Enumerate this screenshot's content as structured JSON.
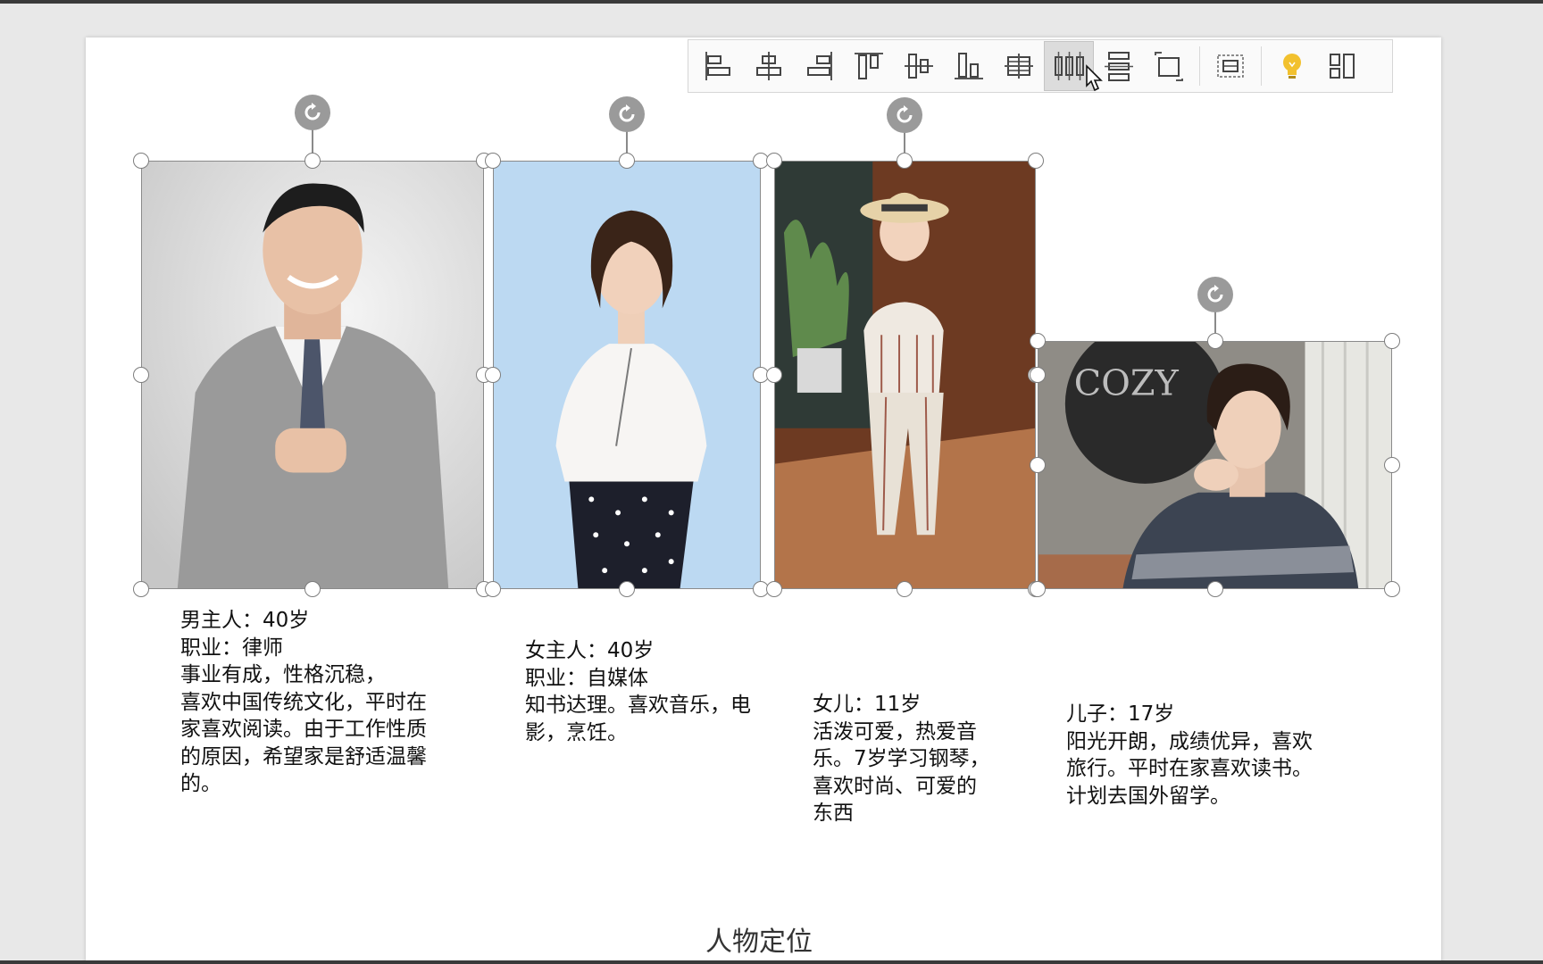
{
  "toolbar": {
    "buttons": [
      {
        "icon": "align-left-icon"
      },
      {
        "icon": "align-center-horizontal-icon"
      },
      {
        "icon": "align-right-icon"
      },
      {
        "icon": "align-top-icon"
      },
      {
        "icon": "align-middle-vertical-icon"
      },
      {
        "icon": "align-bottom-icon"
      },
      {
        "icon": "align-center-both-icon"
      },
      {
        "icon": "distribute-horizontal-icon",
        "active": true
      },
      {
        "icon": "distribute-vertical-icon"
      },
      {
        "icon": "fit-to-slide-icon"
      },
      {
        "icon": "align-to-slide-icon"
      },
      {
        "icon": "lightbulb-icon"
      },
      {
        "icon": "more-layout-icon"
      }
    ]
  },
  "people": [
    {
      "id": "father",
      "text": "男主人：40岁\n职业：律师\n事业有成，性格沉稳，\n喜欢中国传统文化，平时在\n家喜欢阅读。由于工作性质\n的原因，希望家是舒适温馨\n的。"
    },
    {
      "id": "mother",
      "text": "女主人：40岁\n职业：自媒体\n知书达理。喜欢音乐，电\n影，烹饪。"
    },
    {
      "id": "daughter",
      "text": "女儿：11岁\n活泼可爱，热爱音\n乐。7岁学习钢琴，\n喜欢时尚、可爱的\n东西"
    },
    {
      "id": "son",
      "text": "儿子：17岁\n阳光开朗，成绩优异，喜欢\n旅行。平时在家喜欢读书。\n计划去国外留学。"
    }
  ],
  "slide_title": "人物定位",
  "colors": {
    "toolbar_bg": "#fafafa",
    "handle_border": "#7d7d7d",
    "accent_bulb": "#f2c12e"
  }
}
